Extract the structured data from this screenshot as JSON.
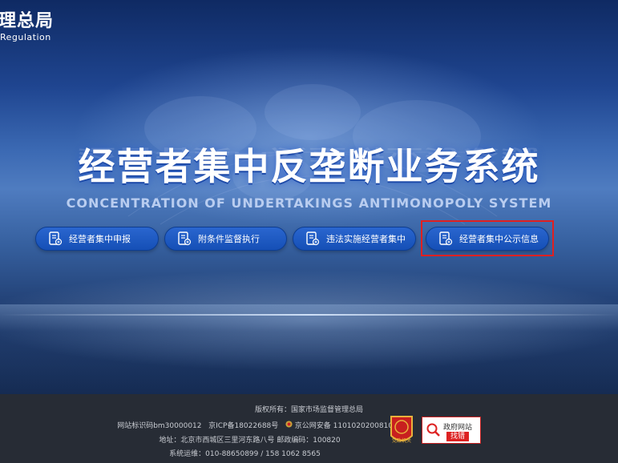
{
  "header": {
    "logo_cn": "理总局",
    "logo_en": "Regulation"
  },
  "hero": {
    "title": "经营者集中反垄断业务系统",
    "subtitle": "CONCENTRATION OF UNDERTAKINGS ANTIMONOPOLY SYSTEM"
  },
  "nav": [
    {
      "label": "经营者集中申报"
    },
    {
      "label": "附条件监督执行"
    },
    {
      "label": "违法实施经营者集中"
    },
    {
      "label": "经营者集中公示信息"
    }
  ],
  "colors": {
    "button": "#1b58c2",
    "highlight": "#e02020",
    "footer": "#272c35"
  },
  "footer": {
    "copyright": "版权所有：国家市场监督管理总局",
    "site_id": "网站标识码bm30000012",
    "icp": "京ICP备18022688号",
    "police": "京公网安备 11010202008101号",
    "address": "地址：北京市西城区三里河东路八号   邮政编码：100820",
    "support": "系统运维：010-88650899 / 158 1062 8565",
    "badge_party": "党政机关",
    "badge_gov_top": "政府网站",
    "badge_gov_bottom": "找错"
  }
}
